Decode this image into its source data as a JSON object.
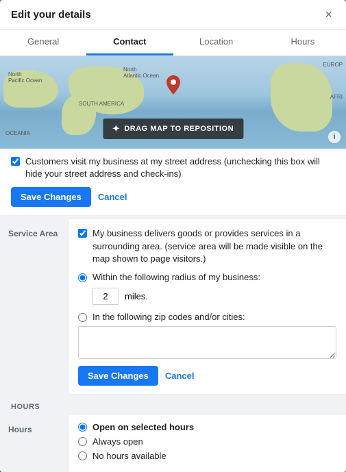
{
  "modal": {
    "title": "Edit your details",
    "close_label": "×"
  },
  "tabs": [
    {
      "label": "General",
      "active": false
    },
    {
      "label": "Contact",
      "active": true
    },
    {
      "label": "Location",
      "active": false
    },
    {
      "label": "Hours",
      "active": false
    }
  ],
  "map": {
    "drag_btn_label": "DRAG MAP TO REPOSITION",
    "info_icon": "ℹ",
    "drag_icon": "✦"
  },
  "street_address": {
    "checkbox_checked": true,
    "label": "Customers visit my business at my street address (unchecking this box will hide your street address and check-ins)",
    "save_label": "Save Changes",
    "cancel_label": "Cancel"
  },
  "service_area": {
    "section_label": "Service Area",
    "checkbox_checked": true,
    "checkbox_label": "My business delivers goods or provides services in a surrounding area. (service area will be made visible on the map shown to page visitors.)",
    "radius_radio_label": "Within the following radius of my business:",
    "radius_value": "2",
    "miles_label": "miles.",
    "zipcode_radio_label": "In the following zip codes and/or cities:",
    "zipcode_value": "",
    "save_label": "Save Changes",
    "cancel_label": "Cancel"
  },
  "hours": {
    "section_header": "HOURS",
    "section_label": "Hours",
    "option_selected": "Open on selected hours",
    "option_always": "Always open",
    "option_none": "No hours available",
    "radio_options": [
      {
        "label": "Open on selected hours",
        "selected": true
      },
      {
        "label": "Always open",
        "selected": false
      },
      {
        "label": "No hours available",
        "selected": false
      }
    ]
  }
}
